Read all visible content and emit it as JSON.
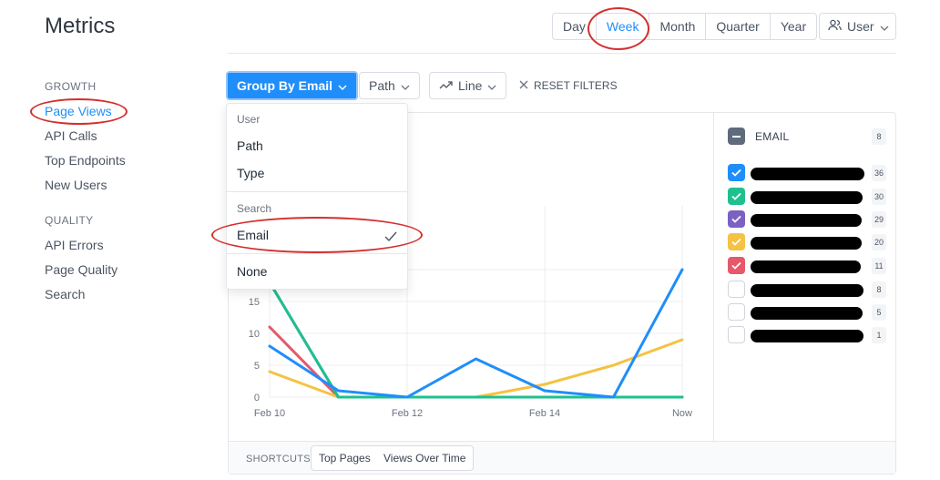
{
  "header": {
    "title": "Metrics",
    "periods": [
      "Day",
      "Week",
      "Month",
      "Quarter",
      "Year"
    ],
    "active_period": "Week",
    "user_menu": "User"
  },
  "sidebar": {
    "growth_label": "GROWTH",
    "growth_items": [
      "Page Views",
      "API Calls",
      "Top Endpoints",
      "New Users"
    ],
    "quality_label": "QUALITY",
    "quality_items": [
      "API Errors",
      "Page Quality",
      "Search"
    ],
    "active_item": "Page Views"
  },
  "toolbar": {
    "group_by": "Group By Email",
    "path": "Path",
    "chart_type": "Line",
    "reset": "RESET FILTERS"
  },
  "dropdown": {
    "user_header": "User",
    "path": "Path",
    "type": "Type",
    "search_header": "Search",
    "email": "Email",
    "none": "None"
  },
  "legend": {
    "header": "EMAIL",
    "header_count": "8",
    "items": [
      {
        "count": "36",
        "color": "#1f8efa",
        "checked": true
      },
      {
        "count": "30",
        "color": "#1fc08e",
        "checked": true
      },
      {
        "count": "29",
        "color": "#7b61c2",
        "checked": true
      },
      {
        "count": "20",
        "color": "#f5c242",
        "checked": true
      },
      {
        "count": "11",
        "color": "#e6586a",
        "checked": true
      },
      {
        "count": "8",
        "color": "#ffffff",
        "checked": false
      },
      {
        "count": "5",
        "color": "#ffffff",
        "checked": false
      },
      {
        "count": "1",
        "color": "#ffffff",
        "checked": false
      }
    ]
  },
  "footer": {
    "shortcuts_label": "SHORTCUTS",
    "top_pages": "Top Pages",
    "views_over_time": "Views Over Time"
  },
  "chart_data": {
    "type": "line",
    "x": [
      "Feb 10",
      "Feb 11",
      "Feb 12",
      "Feb 13",
      "Feb 14",
      "Feb 15",
      "Now"
    ],
    "x_tick_labels": [
      "Feb 10",
      "Feb 12",
      "Feb 14",
      "Now"
    ],
    "y_tick_labels": [
      "0",
      "5",
      "10",
      "15"
    ],
    "series": [
      {
        "color": "#1f8efa",
        "values": [
          8,
          1,
          0,
          6,
          1,
          0,
          20
        ]
      },
      {
        "color": "#1fc08e",
        "values": [
          18,
          0,
          0,
          0,
          0,
          0,
          0
        ]
      },
      {
        "color": "#7b61c2",
        "values": [
          18,
          0,
          0,
          0,
          0,
          0,
          0
        ]
      },
      {
        "color": "#f5c242",
        "values": [
          4,
          0,
          0,
          0,
          2,
          5,
          9
        ]
      },
      {
        "color": "#e6586a",
        "values": [
          11,
          0,
          0,
          0,
          0,
          0,
          0
        ]
      }
    ]
  }
}
